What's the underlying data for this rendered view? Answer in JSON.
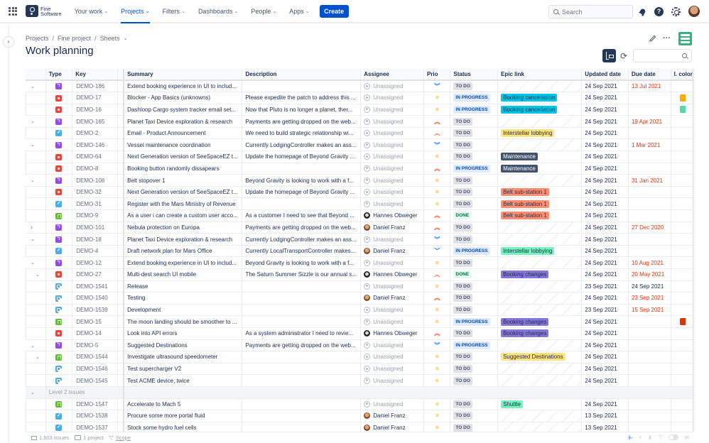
{
  "topnav": {
    "logo_line1": "Fine",
    "logo_line2": "Software",
    "items": [
      {
        "label": "Your work",
        "active": false
      },
      {
        "label": "Projects",
        "active": true
      },
      {
        "label": "Filters",
        "active": false
      },
      {
        "label": "Dashboards",
        "active": false
      },
      {
        "label": "People",
        "active": false
      },
      {
        "label": "Apps",
        "active": false
      }
    ],
    "create_label": "Create",
    "search_placeholder": "Search",
    "help_glyph": "?"
  },
  "breadcrumb": [
    "Projects",
    "Fine project",
    "Sheets"
  ],
  "page_title": "Work planning",
  "toolbar": {
    "more_glyph": "···",
    "refresh_glyph": "⟳"
  },
  "columns": [
    "",
    "Type",
    "Key",
    "",
    "Summary",
    "Description",
    "Assignee",
    "Prio",
    "Status",
    "Epic link",
    "Updated date",
    "Due date",
    "I. color"
  ],
  "colors": {
    "accent": "#0052cc",
    "due_overdue": "#de350b",
    "epic_booking_cancellation": "#00c7e6",
    "epic_interstellar_yellow": "#ffe380",
    "epic_maintenance": "#42526e",
    "epic_belt": "#ff8f73",
    "epic_interstellar_green": "#79f2c0",
    "epic_booking_changes": "#8777d9",
    "epic_suggested": "#ffe380",
    "epic_shuttle": "#79f2c0"
  },
  "rows": [
    {
      "level": 0,
      "expand": "down",
      "type": "epic",
      "key": "DEMO-186",
      "summary": "Extend booking experience in UI to includ...",
      "description": "",
      "assignee": "Unassigned",
      "avatar": "unassigned",
      "prio": "lowest",
      "status": "TO DO",
      "epic": "",
      "epic_color": "",
      "epic_text": "",
      "updated": "24 Sep 2021",
      "due": "13 Jul 2021",
      "due_overdue": true,
      "icolor": ""
    },
    {
      "level": 1,
      "expand": "",
      "type": "bug",
      "key": "DEMO-17",
      "summary": "Blocker - App Basics (unknowns)",
      "description": "Please expedite the patch to address this ...",
      "assignee": "Unassigned",
      "avatar": "unassigned",
      "prio": "medium",
      "status": "IN PROGRESS",
      "epic": "Booking cancellation",
      "epic_color": "#00c7e6",
      "epic_text": "#172b4d",
      "updated": "24 Sep 2021",
      "due": "",
      "due_overdue": false,
      "icolor": "#ffab00"
    },
    {
      "level": 1,
      "expand": "",
      "type": "bug",
      "key": "DEMO-16",
      "summary": "Dashloop Cargo system tracker email set...",
      "description": "Now that Pluto is no longer a planet, ther...",
      "assignee": "Unassigned",
      "avatar": "unassigned",
      "prio": "medium",
      "status": "IN PROGRESS",
      "epic": "Booking cancellation",
      "epic_color": "#00c7e6",
      "epic_text": "#172b4d",
      "updated": "24 Sep 2021",
      "due": "",
      "due_overdue": false,
      "icolor": "#57d9a3"
    },
    {
      "level": 0,
      "expand": "down",
      "type": "epic",
      "key": "DEMO-165",
      "summary": "Planet Taxi Device exploration & research",
      "description": "Payments are getting dropped on the web...",
      "assignee": "Unassigned",
      "avatar": "unassigned",
      "prio": "highest",
      "status": "TO DO",
      "epic": "",
      "epic_color": "",
      "epic_text": "",
      "updated": "24 Sep 2021",
      "due": "19 Apr 2021",
      "due_overdue": true,
      "icolor": ""
    },
    {
      "level": 1,
      "expand": "",
      "type": "task",
      "key": "DEMO-2",
      "summary": "Email - Product Announcement",
      "description": "We need to build strategic relationship wi...",
      "assignee": "Unassigned",
      "avatar": "unassigned",
      "prio": "high",
      "status": "TO DO",
      "epic": "Interstellar lobbying",
      "epic_color": "#ffe380",
      "epic_text": "#172b4d",
      "updated": "24 Sep 2021",
      "due": "",
      "due_overdue": false,
      "icolor": ""
    },
    {
      "level": 0,
      "expand": "down",
      "type": "epic",
      "key": "DEMO-146",
      "summary": "Vessel maintenance coordination",
      "description": "Currently LodgingController makes an ass...",
      "assignee": "Unassigned",
      "avatar": "unassigned",
      "prio": "lowest",
      "status": "TO DO",
      "epic": "",
      "epic_color": "",
      "epic_text": "",
      "updated": "24 Sep 2021",
      "due": "1 Mar 2021",
      "due_overdue": true,
      "icolor": ""
    },
    {
      "level": 1,
      "expand": "",
      "type": "bug",
      "key": "DEMO-64",
      "summary": "Next Generation version of SeeSpaceEZ t...",
      "description": "Update the homepage of Beyond Gravity ...",
      "assignee": "Unassigned",
      "avatar": "unassigned",
      "prio": "medium",
      "status": "TO DO",
      "epic": "Maintenance",
      "epic_color": "#42526e",
      "epic_text": "#ffffff",
      "updated": "24 Sep 2021",
      "due": "",
      "due_overdue": false,
      "icolor": ""
    },
    {
      "level": 1,
      "expand": "",
      "type": "bug",
      "key": "DEMO-8",
      "summary": "Booking button randomly dissapears",
      "description": "",
      "assignee": "Unassigned",
      "avatar": "unassigned",
      "prio": "highest",
      "status": "IN PROGRESS",
      "epic": "Maintenance",
      "epic_color": "#42526e",
      "epic_text": "#ffffff",
      "updated": "24 Sep 2021",
      "due": "",
      "due_overdue": false,
      "icolor": ""
    },
    {
      "level": 0,
      "expand": "down",
      "type": "epic",
      "key": "DEMO-108",
      "summary": "Belt stopover 1",
      "description": "Beyond Gravity is looking to work with a f...",
      "assignee": "Unassigned",
      "avatar": "unassigned",
      "prio": "medium",
      "status": "TO DO",
      "epic": "",
      "epic_color": "",
      "epic_text": "",
      "updated": "24 Sep 2021",
      "due": "31 Jan 2021",
      "due_overdue": true,
      "icolor": ""
    },
    {
      "level": 1,
      "expand": "",
      "type": "bug",
      "key": "DEMO-32",
      "summary": "Next Generation version of SeeSpaceEZ t...",
      "description": "Update the homepage of Beyond Gravity ...",
      "assignee": "Unassigned",
      "avatar": "unassigned",
      "prio": "medium",
      "status": "TO DO",
      "epic": "Belt sub-station 1",
      "epic_color": "#ff8f73",
      "epic_text": "#172b4d",
      "updated": "24 Sep 2021",
      "due": "",
      "due_overdue": false,
      "icolor": ""
    },
    {
      "level": 1,
      "expand": "",
      "type": "task",
      "key": "DEMO-31",
      "summary": "Register with the Mars Ministry of Revenue",
      "description": "",
      "assignee": "Unassigned",
      "avatar": "unassigned",
      "prio": "medium",
      "status": "TO DO",
      "epic": "Belt sub-station 1",
      "epic_color": "#ff8f73",
      "epic_text": "#172b4d",
      "updated": "24 Sep 2021",
      "due": "",
      "due_overdue": false,
      "icolor": ""
    },
    {
      "level": 1,
      "expand": "",
      "type": "story",
      "key": "DEMO-9",
      "summary": "As a user i can create a custom user acco...",
      "description": "As a customer I need to see that Beyond ...",
      "assignee": "Hannes Obweger",
      "avatar": "hannes",
      "prio": "highest",
      "status": "DONE",
      "epic": "Belt sub-station 1",
      "epic_color": "#ff8f73",
      "epic_text": "#172b4d",
      "updated": "24 Sep 2021",
      "due": "",
      "due_overdue": false,
      "icolor": ""
    },
    {
      "level": 0,
      "expand": "right",
      "type": "epic",
      "key": "DEMO-101",
      "summary": "Nebula protection on Europa",
      "description": "Payments are getting dropped on the web...",
      "assignee": "Daniel Franz",
      "avatar": "daniel",
      "prio": "highest",
      "status": "TO DO",
      "epic": "",
      "epic_color": "",
      "epic_text": "",
      "updated": "24 Sep 2021",
      "due": "27 Dec 2020",
      "due_overdue": true,
      "icolor": ""
    },
    {
      "level": 0,
      "expand": "down",
      "type": "epic",
      "key": "DEMO-18",
      "summary": "Planet Taxi Device exploration & research",
      "description": "Currently LodgingController makes an ass...",
      "assignee": "Unassigned",
      "avatar": "unassigned",
      "prio": "lowest",
      "status": "TO DO",
      "epic": "",
      "epic_color": "",
      "epic_text": "",
      "updated": "24 Sep 2021",
      "due": "",
      "due_overdue": false,
      "icolor": ""
    },
    {
      "level": 1,
      "expand": "",
      "type": "task",
      "key": "DEMO-4",
      "summary": "Draft network plan for Mars Office",
      "description": "Currently LocalTransportController makes...",
      "assignee": "Daniel Franz",
      "avatar": "daniel",
      "prio": "low",
      "status": "IN PROGRESS",
      "epic": "Interstellar lobbying",
      "epic_color": "#79f2c0",
      "epic_text": "#172b4d",
      "updated": "24 Sep 2021",
      "due": "",
      "due_overdue": false,
      "icolor": ""
    },
    {
      "level": 0,
      "expand": "down",
      "type": "epic",
      "key": "DEMO-12",
      "summary": "Extend booking experience in UI to includ...",
      "description": "Beyond Gravity is looking to work with a f...",
      "assignee": "Unassigned",
      "avatar": "unassigned",
      "prio": "medium",
      "status": "TO DO",
      "epic": "",
      "epic_color": "",
      "epic_text": "",
      "updated": "24 Sep 2021",
      "due": "10 Aug 2021",
      "due_overdue": true,
      "icolor": ""
    },
    {
      "level": 1,
      "expand": "down",
      "type": "bug",
      "key": "DEMO-27",
      "summary": "Multi-dest search UI mobile",
      "description": "The Saturn Summer Sizzle is our annual s...",
      "assignee": "Hannes Obweger",
      "avatar": "hannes",
      "prio": "high",
      "status": "DONE",
      "epic": "Booking changes",
      "epic_color": "#8777d9",
      "epic_text": "#172b4d",
      "updated": "24 Sep 2021",
      "due": "20 May 2021",
      "due_overdue": true,
      "icolor": ""
    },
    {
      "level": 2,
      "expand": "",
      "type": "subtask",
      "key": "DEMO-1541",
      "summary": "Release",
      "description": "",
      "assignee": "Unassigned",
      "avatar": "unassigned",
      "prio": "medium",
      "status": "TO DO",
      "epic": "",
      "epic_color": "",
      "epic_text": "",
      "updated": "23 Sep 2021",
      "due": "24 Sep 2021",
      "due_overdue": false,
      "icolor": ""
    },
    {
      "level": 2,
      "expand": "",
      "type": "subtask",
      "key": "DEMO-1540",
      "summary": "Testing",
      "description": "",
      "assignee": "Daniel Franz",
      "avatar": "daniel",
      "prio": "highest",
      "status": "TO DO",
      "epic": "",
      "epic_color": "",
      "epic_text": "",
      "updated": "24 Sep 2021",
      "due": "23 Sep 2021",
      "due_overdue": true,
      "icolor": ""
    },
    {
      "level": 2,
      "expand": "",
      "type": "subtask",
      "key": "DEMO-1539",
      "summary": "Development",
      "description": "",
      "assignee": "Unassigned",
      "avatar": "unassigned",
      "prio": "medium",
      "status": "TO DO",
      "epic": "",
      "epic_color": "",
      "epic_text": "",
      "updated": "23 Sep 2021",
      "due": "15 Sep 2021",
      "due_overdue": true,
      "icolor": ""
    },
    {
      "level": 1,
      "expand": "",
      "type": "story",
      "key": "DEMO-15",
      "summary": "The moon landing should be smoother to ...",
      "description": "",
      "assignee": "Unassigned",
      "avatar": "unassigned",
      "prio": "medium",
      "status": "IN PROGRESS",
      "epic": "Booking changes",
      "epic_color": "#8777d9",
      "epic_text": "#172b4d",
      "updated": "24 Sep 2021",
      "due": "",
      "due_overdue": false,
      "icolor": "#de350b"
    },
    {
      "level": 1,
      "expand": "",
      "type": "bug",
      "key": "DEMO-14",
      "summary": "Look into API errors",
      "description": "As a system administrator I need to revie...",
      "assignee": "Hannes Obweger",
      "avatar": "hannes",
      "prio": "highest",
      "status": "TO DO",
      "epic": "Booking changes",
      "epic_color": "#8777d9",
      "epic_text": "#172b4d",
      "updated": "24 Sep 2021",
      "due": "",
      "due_overdue": false,
      "icolor": ""
    },
    {
      "level": 0,
      "expand": "down",
      "type": "epic",
      "key": "DEMO-5",
      "summary": "Suggested Destinations",
      "description": "Payments are getting dropped on the web...",
      "assignee": "Unassigned",
      "avatar": "unassigned",
      "prio": "lowest",
      "status": "IN PROGRESS",
      "epic": "",
      "epic_color": "",
      "epic_text": "",
      "updated": "24 Sep 2021",
      "due": "",
      "due_overdue": false,
      "icolor": ""
    },
    {
      "level": 1,
      "expand": "down",
      "type": "story",
      "key": "DEMO-1544",
      "summary": "Investigate ultrasound speedometer",
      "description": "",
      "assignee": "Unassigned",
      "avatar": "unassigned",
      "prio": "medium",
      "status": "TO DO",
      "epic": "Suggested Destinations",
      "epic_color": "#ffe380",
      "epic_text": "#172b4d",
      "updated": "24 Sep 2021",
      "due": "",
      "due_overdue": false,
      "icolor": ""
    },
    {
      "level": 2,
      "expand": "",
      "type": "subtask",
      "key": "DEMO-1546",
      "summary": "Test supercharger V2",
      "description": "",
      "assignee": "Unassigned",
      "avatar": "unassigned",
      "prio": "medium",
      "status": "TO DO",
      "epic": "",
      "epic_color": "",
      "epic_text": "",
      "updated": "24 Sep 2021",
      "due": "",
      "due_overdue": false,
      "icolor": ""
    },
    {
      "level": 2,
      "expand": "",
      "type": "subtask",
      "key": "DEMO-1545",
      "summary": "Test ACME device, twice",
      "description": "",
      "assignee": "Unassigned",
      "avatar": "unassigned",
      "prio": "medium",
      "status": "TO DO",
      "epic": "",
      "epic_color": "",
      "epic_text": "",
      "updated": "24 Sep 2021",
      "due": "",
      "due_overdue": false,
      "icolor": ""
    },
    {
      "group": true,
      "label": "Level 2 issues"
    },
    {
      "level": 1,
      "expand": "",
      "type": "story",
      "key": "DEMO-1547",
      "summary": "Accelerate to Mach 5",
      "description": "",
      "assignee": "Unassigned",
      "avatar": "unassigned",
      "prio": "medium",
      "status": "TO DO",
      "epic": "Shuttle",
      "epic_color": "#79f2c0",
      "epic_text": "#172b4d",
      "updated": "24 Sep 2021",
      "due": "",
      "due_overdue": false,
      "icolor": ""
    },
    {
      "level": 1,
      "expand": "",
      "type": "task",
      "key": "DEMO-1538",
      "summary": "Procure some more portal fluid",
      "description": "",
      "assignee": "Daniel Franz",
      "avatar": "daniel",
      "prio": "medium",
      "status": "TO DO",
      "epic": "",
      "epic_color": "",
      "epic_text": "",
      "updated": "13 Sep 2021",
      "due": "",
      "due_overdue": false,
      "icolor": ""
    },
    {
      "level": 1,
      "expand": "",
      "type": "task",
      "key": "DEMO-1537",
      "summary": "Stock some hydro fuel cells",
      "description": "",
      "assignee": "Daniel Franz",
      "avatar": "daniel",
      "prio": "medium",
      "status": "TO DO",
      "epic": "",
      "epic_color": "",
      "epic_text": "",
      "updated": "13 Sep 2021",
      "due": "",
      "due_overdue": false,
      "icolor": ""
    }
  ],
  "prio_glyphs": {
    "lowest": "︾",
    "low": "﹀",
    "medium": "=",
    "high": "︿",
    "highest": "︽"
  },
  "footer": {
    "issues": "1,503 issues",
    "projects": "1 project",
    "scope": "Scope"
  }
}
